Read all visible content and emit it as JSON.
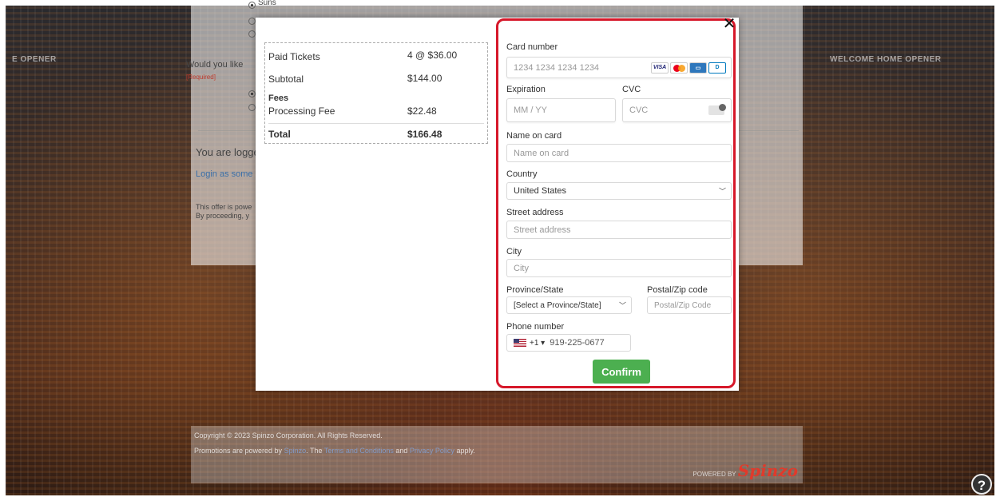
{
  "top_caption": "Suns",
  "background": {
    "banner_left": "E OPENER",
    "banner_right": "WELCOME HOME OPENER"
  },
  "page": {
    "radio_suns_label": "Suns",
    "question": "Would you like",
    "required_label": "[Required]",
    "logged_in_text": "You are logge",
    "login_other_link": "Login as some",
    "offer_line1": "This offer is powe",
    "offer_line2": "By proceeding, y"
  },
  "footer": {
    "copyright": "Copyright © 2023 Spinzo Corporation. All Rights Reserved.",
    "powered_prefix": "Promotions are powered by",
    "powered_link": "Spinzo",
    "terms_prefix": ". The",
    "terms_link": "Terms and Conditions",
    "and": "and",
    "privacy_link": "Privacy Policy",
    "apply": "apply.",
    "powered_by_label": "POWERED BY",
    "brand": "Spinzo"
  },
  "help_button": "?",
  "order_summary": {
    "paid_tickets_label": "Paid Tickets",
    "paid_tickets_value": "4 @ $36.00",
    "subtotal_label": "Subtotal",
    "subtotal_value": "$144.00",
    "fees_label": "Fees",
    "processing_fee_label": "Processing Fee",
    "processing_fee_value": "$22.48",
    "total_label": "Total",
    "total_value": "$166.48"
  },
  "modal": {
    "close_glyph": "✕"
  },
  "payment_form": {
    "card_number_label": "Card number",
    "card_number_placeholder": "1234 1234 1234 1234",
    "card_brands": [
      "VISA",
      "mastercard",
      "amex",
      "discover"
    ],
    "expiration_label": "Expiration",
    "expiration_placeholder": "MM / YY",
    "cvc_label": "CVC",
    "cvc_placeholder": "CVC",
    "name_label": "Name on card",
    "name_placeholder": "Name on card",
    "country_label": "Country",
    "country_value": "United States",
    "street_label": "Street address",
    "street_placeholder": "Street address",
    "city_label": "City",
    "city_placeholder": "City",
    "province_label": "Province/State",
    "province_value": "[Select a Province/State]",
    "postal_label": "Postal/Zip code",
    "postal_placeholder": "Postal/Zip Code",
    "phone_label": "Phone number",
    "phone_prefix": "+1 ▾",
    "phone_value": "919-225-0677",
    "confirm_label": "Confirm",
    "highlight_color": "#d6182a",
    "confirm_color": "#4caf50"
  }
}
